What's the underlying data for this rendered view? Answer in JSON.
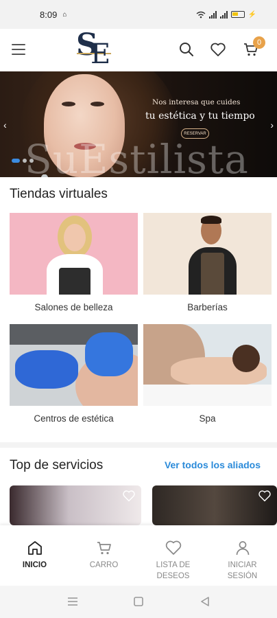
{
  "status_bar": {
    "time": "8:09",
    "battery_color": "#f1c40f"
  },
  "header": {
    "cart_count": "0",
    "logo_letters": "SE",
    "brand_color": "#1f2f4a",
    "accent_color": "#c9a65a"
  },
  "banner": {
    "subtitle": "Nos interesa que cuides",
    "title": "tu estética y tu tiempo",
    "button": "RESERVAR",
    "watermark": "SuEstilista"
  },
  "stores": {
    "title": "Tiendas virtuales",
    "items": [
      {
        "label": "Salones de belleza"
      },
      {
        "label": "Barberías"
      },
      {
        "label": "Centros de estética"
      },
      {
        "label": "Spa"
      }
    ]
  },
  "services": {
    "title": "Top de servicios",
    "see_all": "Ver todos los aliados"
  },
  "bottom_nav": {
    "items": [
      {
        "label": "INICIO",
        "icon": "home-icon"
      },
      {
        "label": "CARRO",
        "icon": "cart-icon"
      },
      {
        "label": "LISTA DE DESEOS",
        "icon": "heart-icon"
      },
      {
        "label": "INICIAR SESIÓN",
        "icon": "user-icon"
      }
    ]
  },
  "colors": {
    "link": "#2a8ad9",
    "badge": "#e8a24a",
    "dot_active": "#3b8be0"
  }
}
